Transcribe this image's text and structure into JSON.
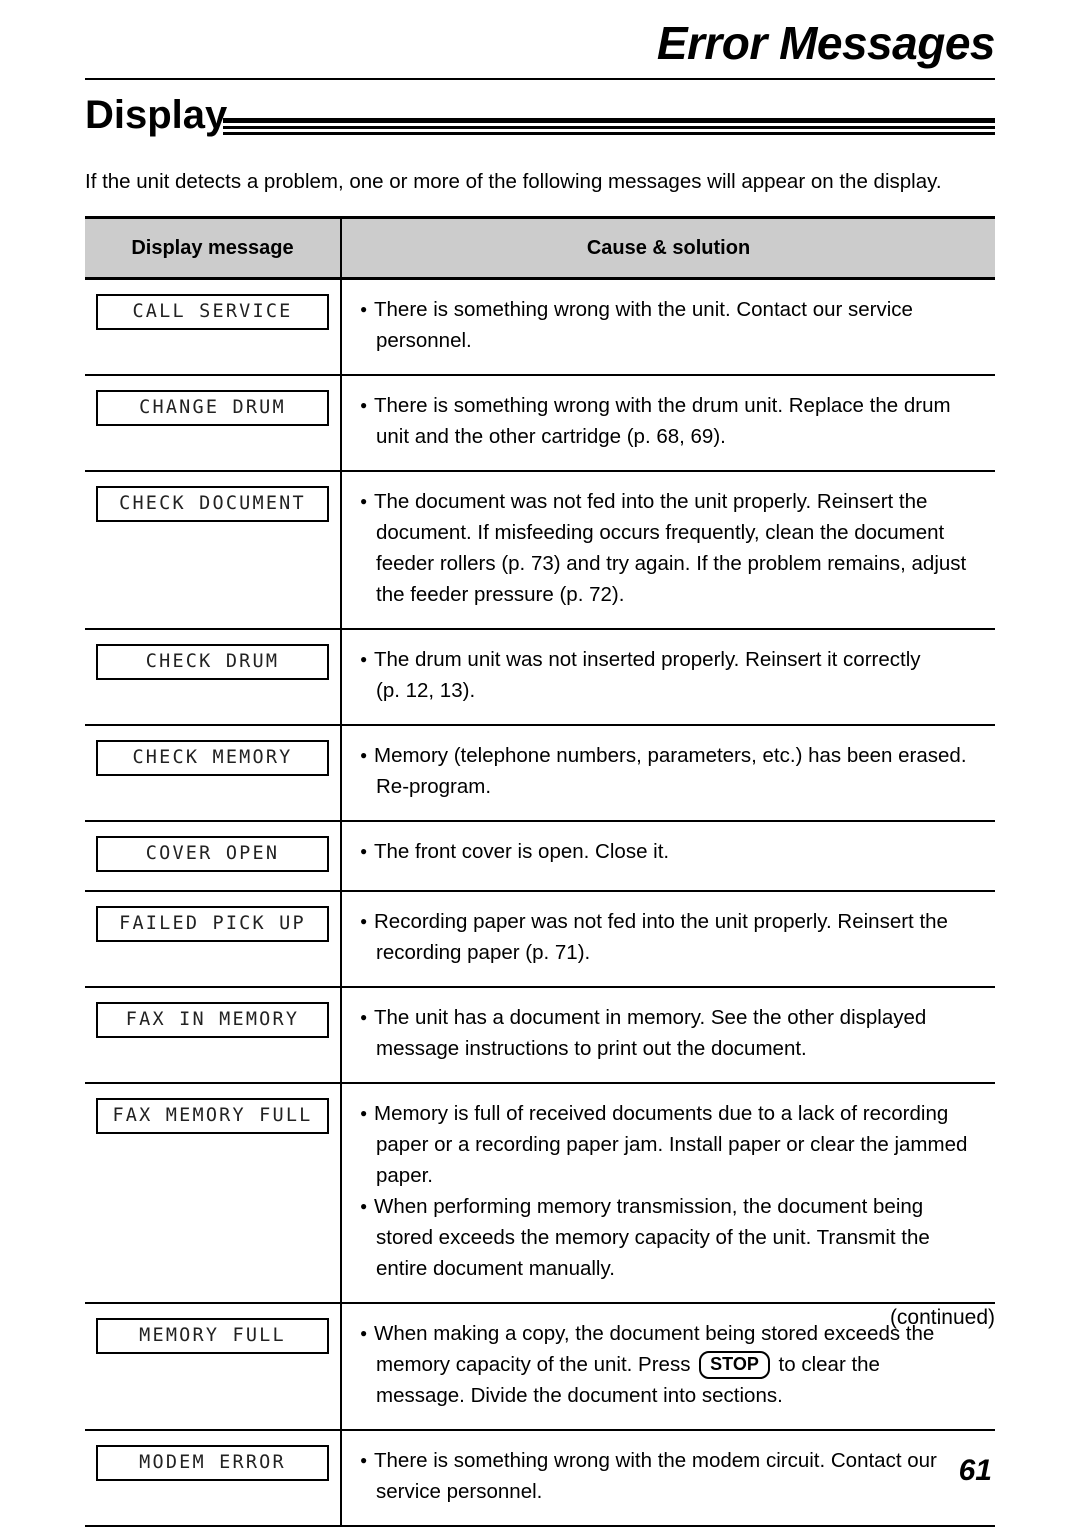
{
  "chapter": {
    "title": "Error Messages"
  },
  "section": {
    "title": "Display"
  },
  "intro": "If the unit detects a problem, one or more of the following messages will appear on the display.",
  "table": {
    "headers": {
      "message": "Display message",
      "cause": "Cause & solution"
    },
    "header_bg": "#cccccc",
    "rows": [
      {
        "message": "CALL SERVICE",
        "bullets": [
          {
            "lines": [
              "There is something wrong with the unit. Contact our service",
              "personnel."
            ]
          }
        ]
      },
      {
        "message": "CHANGE DRUM",
        "bullets": [
          {
            "lines": [
              "There is something wrong with the drum unit. Replace the drum",
              "unit and the other cartridge (p. 68, 69)."
            ]
          }
        ]
      },
      {
        "message": "CHECK DOCUMENT",
        "bullets": [
          {
            "lines": [
              "The document was not fed into the unit properly. Reinsert the",
              "document. If misfeeding occurs frequently, clean the document",
              "feeder rollers (p. 73) and try again. If the problem remains, adjust",
              "the feeder pressure (p. 72)."
            ]
          }
        ]
      },
      {
        "message": "CHECK DRUM",
        "bullets": [
          {
            "lines": [
              "The drum unit was not inserted properly. Reinsert it correctly",
              "(p. 12, 13)."
            ]
          }
        ]
      },
      {
        "message": "CHECK MEMORY",
        "bullets": [
          {
            "lines": [
              "Memory (telephone numbers, parameters, etc.) has been erased.",
              "Re-program."
            ]
          }
        ]
      },
      {
        "message": "COVER OPEN",
        "bullets": [
          {
            "lines": [
              "The front cover is open. Close it."
            ]
          }
        ]
      },
      {
        "message": "FAILED PICK UP",
        "bullets": [
          {
            "lines": [
              "Recording paper was not fed into the unit properly. Reinsert the",
              "recording paper (p. 71)."
            ]
          }
        ]
      },
      {
        "message": "FAX IN MEMORY",
        "bullets": [
          {
            "lines": [
              "The unit has a document in memory. See the other displayed",
              "message instructions to print out the document."
            ]
          }
        ]
      },
      {
        "message": "FAX MEMORY FULL",
        "bullets": [
          {
            "lines": [
              "Memory is full of received documents due to a lack of recording",
              "paper or a recording paper jam. Install paper or clear the jammed",
              "paper."
            ]
          },
          {
            "lines": [
              "When performing memory transmission, the document being",
              "stored exceeds the memory capacity of the unit. Transmit the",
              "entire document manually."
            ]
          }
        ]
      },
      {
        "message": "MEMORY FULL",
        "bullets": [
          {
            "lines": [
              "When making a copy, the document being stored exceeds the",
              "memory capacity of the unit. Press ",
              "message. Divide the document into sections."
            ],
            "keycap": "STOP",
            "keycap_after": " to clear the"
          }
        ]
      },
      {
        "message": "MODEM ERROR",
        "bullets": [
          {
            "lines": [
              "There is something wrong with the modem circuit. Contact our",
              "service personnel."
            ]
          }
        ]
      }
    ]
  },
  "footer": {
    "continued": "(continued)",
    "page_number": "61"
  }
}
